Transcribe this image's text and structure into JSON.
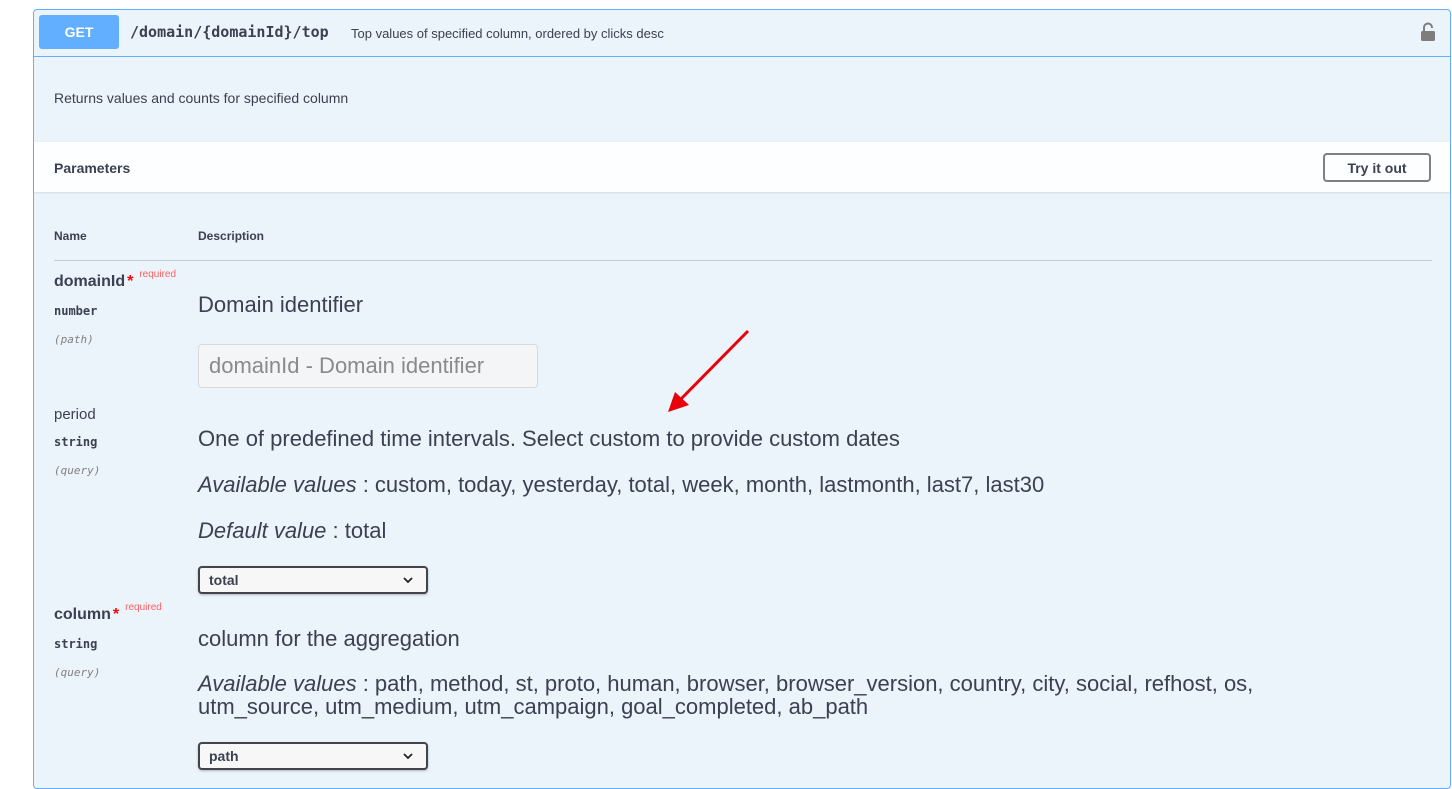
{
  "operation": {
    "method": "GET",
    "path": "/domain/{domainId}/top",
    "summary": "Top values of specified column, ordered by clicks desc",
    "description": "Returns values and counts for specified column",
    "lock_icon": "lock-icon"
  },
  "parameters": {
    "title": "Parameters",
    "try_it_out": "Try it out",
    "col_name": "Name",
    "col_description": "Description",
    "items": [
      {
        "name": "domainId",
        "required_star": "*",
        "required_label": "required",
        "type": "number",
        "in": "(path)",
        "description": "Domain identifier",
        "input_placeholder": "domainId - Domain identifier"
      },
      {
        "name": "period",
        "type": "string",
        "in": "(query)",
        "description": "One of predefined time intervals. Select custom to provide custom dates",
        "available_label": "Available values",
        "available_values": " : custom, today, yesterday, total, week, month, lastmonth, last7, last30",
        "default_label": "Default value",
        "default_value": " : total",
        "selected": "total"
      },
      {
        "name": "column",
        "required_star": "*",
        "required_label": "required",
        "type": "string",
        "in": "(query)",
        "description": "column for the aggregation",
        "available_label": "Available values",
        "available_values": " : path, method, st, proto, human, browser, browser_version, country, city, social, refhost, os, utm_source, utm_medium, utm_campaign, goal_completed, ab_path",
        "selected": "path"
      }
    ]
  },
  "colors": {
    "get_blue": "#61affe",
    "panel_bg": "#ebf3fb",
    "required_red": "#ff0000",
    "annotation_arrow": "#e8000b"
  }
}
